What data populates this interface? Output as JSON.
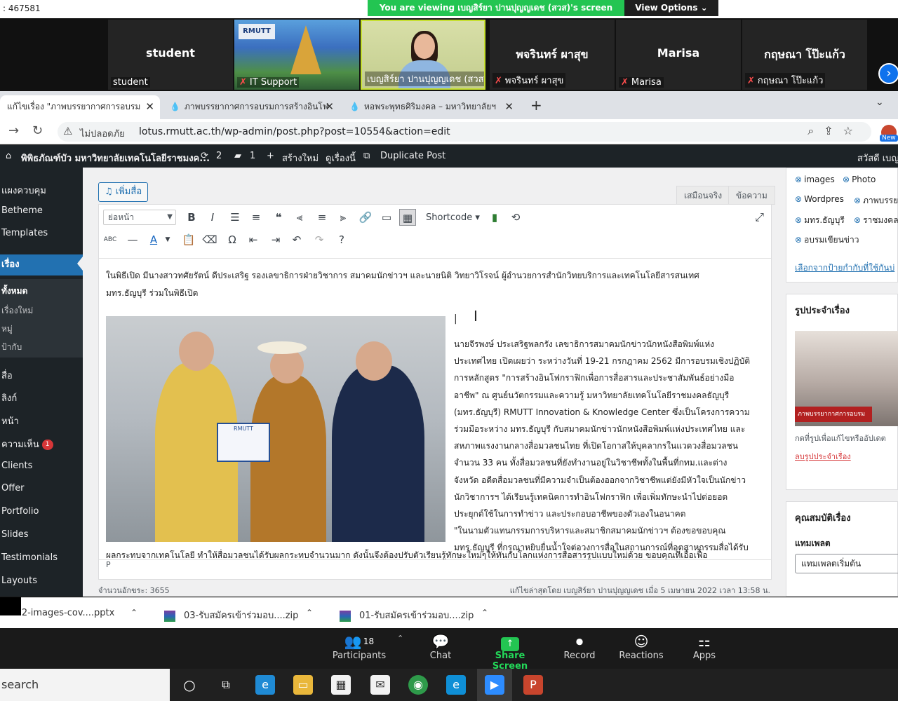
{
  "zoom": {
    "meeting_id": ": 467581",
    "banner": "You are viewing เบญสิร์ยา ปานปุญญเดช (สวส)'s screen",
    "view_options": "View Options ⌄",
    "tiles": [
      {
        "big": "student",
        "label": "student",
        "muted": false
      },
      {
        "big": "",
        "label": "IT Support",
        "muted": true,
        "logo": "RMUTT"
      },
      {
        "big": "",
        "label": "เบญสิร์ยา ปานปุญญเดช (สวส)",
        "muted": false,
        "active": true
      },
      {
        "big": "พจรินทร์ ผาสุข",
        "label": "พจรินทร์ ผาสุข",
        "muted": true
      },
      {
        "big": "Marisa",
        "label": "Marisa",
        "muted": true
      },
      {
        "big": "กฤษณา โป๊ะแก้ว",
        "label": "กฤษณา โป๊ะแก้ว",
        "muted": true
      }
    ],
    "controls": [
      {
        "label": "Participants",
        "icon": "👥",
        "count": "18"
      },
      {
        "label": "Chat",
        "icon": "💬"
      },
      {
        "label": "Share Screen",
        "icon": "↑"
      },
      {
        "label": "Record",
        "icon": "⏺"
      },
      {
        "label": "Reactions",
        "icon": "☺"
      },
      {
        "label": "Apps",
        "icon": "⚏"
      }
    ]
  },
  "browser": {
    "tabs": [
      {
        "title": "แก้ไขเรื่อง \"ภาพบรรยากาศการอบรม",
        "close": "✕"
      },
      {
        "title": "ภาพบรรยากาศการอบรมการสร้างอินโฟ",
        "close": "✕"
      },
      {
        "title": "หอพระพุทธศิริมงคล – มหาวิทยาลัยฯ",
        "close": "✕"
      }
    ],
    "new_tab": "+",
    "insecure_label": "ไม่ปลอดภัย",
    "url": "lotus.rmutt.ac.th/wp-admin/post.php?post=10554&action=edit",
    "new_badge": "New"
  },
  "adminbar": {
    "site": "พิพิธภัณฑ์บัว มหาวิทยาลัยเทคโนโลยีราชมงค...",
    "updates": "2",
    "comments": "1",
    "new": "สร้างใหม่",
    "view": "ดูเรื่องนี้",
    "duplicate": "Duplicate Post",
    "greeting": "สวัสดี เบญ"
  },
  "sidebar": {
    "items": [
      {
        "label": "แผงควบคุม"
      },
      {
        "label": "Betheme"
      },
      {
        "label": "Templates"
      },
      {
        "label": "เรื่อง"
      }
    ],
    "sub": [
      {
        "label": "ทั้งหมด"
      },
      {
        "label": "เรื่องใหม่"
      },
      {
        "label": "หมู่"
      },
      {
        "label": "ป้ากับ"
      }
    ],
    "items2": [
      {
        "label": "สื่อ"
      },
      {
        "label": "ลิงก์"
      },
      {
        "label": "หน้า"
      },
      {
        "label": "ความเห็น",
        "badge": "1"
      },
      {
        "label": "Clients"
      },
      {
        "label": "Offer"
      },
      {
        "label": "Portfolio"
      },
      {
        "label": "Slides"
      },
      {
        "label": "Testimonials"
      },
      {
        "label": "Layouts"
      }
    ]
  },
  "editor": {
    "add_media": "เพิ่มสื่อ",
    "tab_visual": "เสมือนจริง",
    "tab_text": "ข้อความ",
    "format": "ย่อหน้า",
    "shortcode": "Shortcode ▾",
    "para_top": "ในพิธีเปิด มีนางสาวทศัยรัตน์ ดีประเสริฐ รองเลขาธิการฝ่ายวิชาการ สมาคมนักข่าวฯ และนายนิติ วิทยาวิโรจน์ ผู้อำนวยการสำนักวิทยบริการและเทคโนโลยีสารสนเทศ มทร.ธัญบุรี ร่วมในพิธีเปิด",
    "body_lines": [
      "นายจีรพงษ์ ประเสริฐพลกรัง เลขาธิการสมาคมนักข่าวนักหนังสือพิมพ์แห่ง",
      "ประเทศไทย เปิดเผยว่า ระหว่างวันที่ 19-21 กรกฎาคม 2562 มีการอบรมเชิงปฏิบัติ",
      "การหลักสูตร \"การสร้างอินโฟกราฟิกเพื่อการสื่อสารและประชาสัมพันธ์อย่างมือ",
      "อาชีพ\" ณ ศูนย์นวัตกรรมและความรู้ มหาวิทยาลัยเทคโนโลยีราชมงคลธัญบุรี",
      "(มทร.ธัญบุรี) RMUTT Innovation & Knowledge Center ซึ่งเป็นโครงการความ",
      "ร่วมมือระหว่าง มทร.ธัญบุรี กับสมาคมนักข่าวนักหนังสือพิมพ์แห่งประเทศไทย และ",
      "สหภาพแรงงานกลางสื่อมวลชนไทย ที่เปิดโอกาสให้บุคลากรในแวดวงสื่อมวลชน",
      "จำนวน 33 คน ทั้งสื่อมวลชนที่ยังทำงานอยู่ในวิชาชีพทั้งในพื้นที่กทม.และต่าง",
      "จังหวัด อดีตสื่อมวลชนที่มีความจำเป็นต้องออกจากวิชาชีพแต่ยังมีหัวใจเป็นนักข่าว",
      "นักวิชาการฯ ได้เรียนรู้เทคนิคการทำอินโฟกราฟิก เพื่อเพิ่มทักษะนำไปต่อยอด",
      "ประยุกต์ใช้ในการทำข่าว และประกอบอาชีพของตัวเองในอนาคต",
      "\"ในนามตัวแทนกรรมการบริหารและสมาชิกสมาคมนักข่าวฯ ต้องขอขอบคุณ",
      "มทร.ธัญบุรี ที่กรุณาหยิบยื่นน้ำใจต่อวงการสื่อในสถานการณ์ที่อุตสาหกรรมสื่อได้รับ"
    ],
    "para_bottom": "ผลกระทบจากเทคโนโลยี ทำให้สื่อมวลชนได้รับผลกระทบจำนวนมาก ดังนั้นจึงต้องปรับตัวเรียนรู้ทักษะใหม่ๆให้ทันกับโลกแห่งการสื่อสารรูปแบบใหม่ด้วย ขอบคุณที่เอื้อเฟื้อ",
    "photo_cert": "RMUTT",
    "path": "P",
    "wordcount": "จำนวนอักขระ: 3655",
    "last_edit": "แก้ไขล่าสุดโดย เบญสิร์ยา ปานปุญญเดช เมื่อ 5 เมษายน 2022 เวลา 13:58 น."
  },
  "right_panel": {
    "tags": [
      "images",
      "Photo",
      "Wordpres",
      "ภาพบรรย",
      "มทร.ธัญบุรี",
      "ราชมงคล",
      "อบรมเขียนข่าว"
    ],
    "choose_tags": "เลือกจากป้ายกำกับที่ใช้กันบ่",
    "featured_title": "รูปประจำเรื่อง",
    "featured_strip": "ภาพบรรยากาศการอบรม",
    "featured_hint": "กดที่รูปเพื่อแก้ไขหรืออัปเดต",
    "featured_remove": "ลบรูปประจำเรื่อง",
    "attr_title": "คุณสมบัติเรื่อง",
    "template_label": "แทมเพลต",
    "template_value": "แทมเพลตเริ่มต้น"
  },
  "downloads": [
    {
      "name": "2022-images-cov....pptx"
    },
    {
      "name": "03-รับสมัครเข้าร่วมอบ....zip"
    },
    {
      "name": "01-รับสมัครเข้าร่วมอบ....zip"
    }
  ],
  "taskbar": {
    "search": "search"
  }
}
